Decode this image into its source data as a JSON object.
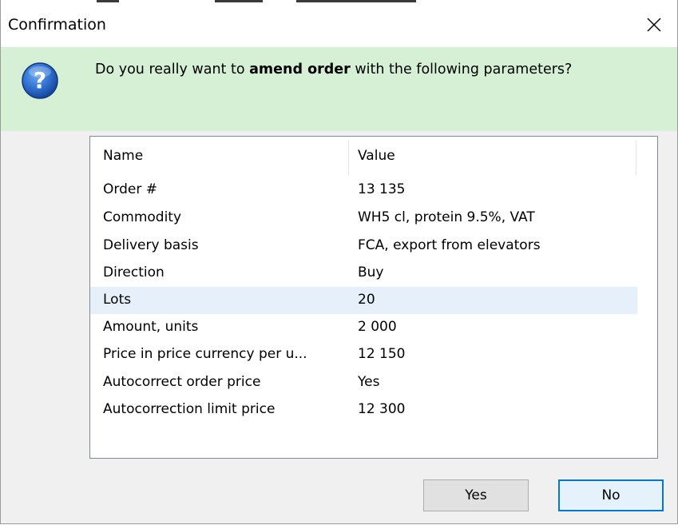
{
  "window": {
    "title": "Confirmation"
  },
  "message": {
    "prefix": "Do you really want to ",
    "emphasis": "amend order",
    "suffix": " with the following parameters?"
  },
  "list": {
    "columns": [
      "Name",
      "Value"
    ],
    "rows": [
      {
        "name": "Order #",
        "value": "13 135"
      },
      {
        "name": "Commodity",
        "value": "WH5 cl, protein 9.5%, VAT"
      },
      {
        "name": "Delivery basis",
        "value": "FCA, export from elevators"
      },
      {
        "name": "Direction",
        "value": "Buy"
      },
      {
        "name": "Lots",
        "value": "20"
      },
      {
        "name": "Amount, units",
        "value": "2 000"
      },
      {
        "name": "Price in price currency per u...",
        "value": "12 150"
      },
      {
        "name": "Autocorrect order price",
        "value": "Yes"
      },
      {
        "name": "Autocorrection limit price",
        "value": "12 300"
      }
    ],
    "selected_row": "Lots"
  },
  "buttons": {
    "yes_label": "Yes",
    "no_label": "No"
  },
  "colors": {
    "message_panel_bg": "#d6f0d6",
    "selected_row_bg": "#e5f0fa",
    "default_button_border": "#0078d7",
    "icon_blue": "#1f5fbf"
  },
  "icons": {
    "dialog_icon": "question-icon",
    "close_icon": "close-icon"
  }
}
